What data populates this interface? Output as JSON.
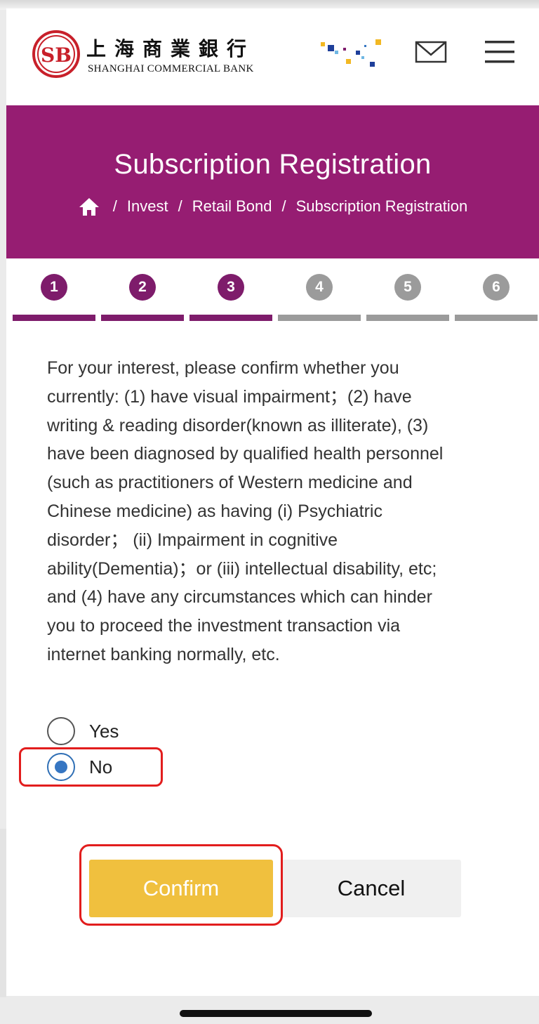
{
  "header": {
    "logo_mark": "SB",
    "logo_chinese": "上海商業銀行",
    "logo_english": "SHANGHAI COMMERCIAL BANK"
  },
  "banner": {
    "title": "Subscription Registration",
    "breadcrumb": [
      "Invest",
      "Retail Bond",
      "Subscription Registration"
    ],
    "separator": "/"
  },
  "steps": [
    {
      "label": "1",
      "state": "active"
    },
    {
      "label": "2",
      "state": "active"
    },
    {
      "label": "3",
      "state": "active"
    },
    {
      "label": "4",
      "state": "inactive"
    },
    {
      "label": "5",
      "state": "inactive"
    },
    {
      "label": "6",
      "state": "inactive"
    }
  ],
  "question": {
    "lines": [
      "For your interest, please confirm whether you",
      "currently: (1) have visual impairment；(2) have",
      "writing & reading disorder(known as illiterate), (3)",
      "have been diagnosed by qualified health personnel",
      "(such as practitioners of Western medicine and",
      "Chinese medicine) as having (i) Psychiatric",
      "disorder； (ii) Impairment in cognitive",
      "ability(Dementia)；or (iii) intellectual disability, etc;",
      "and (4) have any circumstances which can hinder",
      "you to proceed the investment transaction via",
      "internet banking normally, etc."
    ]
  },
  "options": {
    "yes_label": "Yes",
    "no_label": "No",
    "selected": "No"
  },
  "buttons": {
    "confirm": "Confirm",
    "cancel": "Cancel"
  },
  "colors": {
    "brand_purple": "#961d72",
    "step_active": "#7e1c6b",
    "step_inactive": "#9b9b9b",
    "confirm_yellow": "#f0c03e",
    "highlight_red": "#e21d1d",
    "radio_blue": "#3676c2"
  },
  "icons": [
    "scb-logo-icon",
    "brand-dots-icon",
    "mail-icon",
    "menu-icon",
    "home-icon"
  ]
}
